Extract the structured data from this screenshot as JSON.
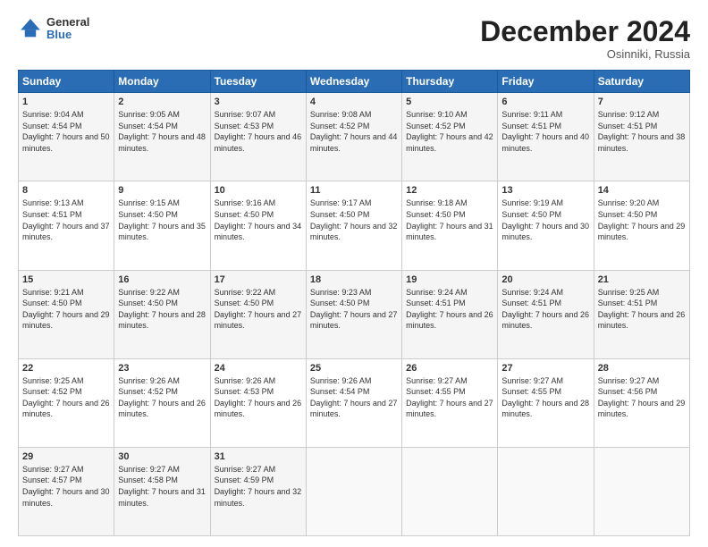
{
  "logo": {
    "general": "General",
    "blue": "Blue"
  },
  "header": {
    "month": "December 2024",
    "location": "Osinniki, Russia"
  },
  "weekdays": [
    "Sunday",
    "Monday",
    "Tuesday",
    "Wednesday",
    "Thursday",
    "Friday",
    "Saturday"
  ],
  "weeks": [
    [
      {
        "day": "1",
        "sunrise": "9:04 AM",
        "sunset": "4:54 PM",
        "daylight": "7 hours and 50 minutes."
      },
      {
        "day": "2",
        "sunrise": "9:05 AM",
        "sunset": "4:54 PM",
        "daylight": "7 hours and 48 minutes."
      },
      {
        "day": "3",
        "sunrise": "9:07 AM",
        "sunset": "4:53 PM",
        "daylight": "7 hours and 46 minutes."
      },
      {
        "day": "4",
        "sunrise": "9:08 AM",
        "sunset": "4:52 PM",
        "daylight": "7 hours and 44 minutes."
      },
      {
        "day": "5",
        "sunrise": "9:10 AM",
        "sunset": "4:52 PM",
        "daylight": "7 hours and 42 minutes."
      },
      {
        "day": "6",
        "sunrise": "9:11 AM",
        "sunset": "4:51 PM",
        "daylight": "7 hours and 40 minutes."
      },
      {
        "day": "7",
        "sunrise": "9:12 AM",
        "sunset": "4:51 PM",
        "daylight": "7 hours and 38 minutes."
      }
    ],
    [
      {
        "day": "8",
        "sunrise": "9:13 AM",
        "sunset": "4:51 PM",
        "daylight": "7 hours and 37 minutes."
      },
      {
        "day": "9",
        "sunrise": "9:15 AM",
        "sunset": "4:50 PM",
        "daylight": "7 hours and 35 minutes."
      },
      {
        "day": "10",
        "sunrise": "9:16 AM",
        "sunset": "4:50 PM",
        "daylight": "7 hours and 34 minutes."
      },
      {
        "day": "11",
        "sunrise": "9:17 AM",
        "sunset": "4:50 PM",
        "daylight": "7 hours and 32 minutes."
      },
      {
        "day": "12",
        "sunrise": "9:18 AM",
        "sunset": "4:50 PM",
        "daylight": "7 hours and 31 minutes."
      },
      {
        "day": "13",
        "sunrise": "9:19 AM",
        "sunset": "4:50 PM",
        "daylight": "7 hours and 30 minutes."
      },
      {
        "day": "14",
        "sunrise": "9:20 AM",
        "sunset": "4:50 PM",
        "daylight": "7 hours and 29 minutes."
      }
    ],
    [
      {
        "day": "15",
        "sunrise": "9:21 AM",
        "sunset": "4:50 PM",
        "daylight": "7 hours and 29 minutes."
      },
      {
        "day": "16",
        "sunrise": "9:22 AM",
        "sunset": "4:50 PM",
        "daylight": "7 hours and 28 minutes."
      },
      {
        "day": "17",
        "sunrise": "9:22 AM",
        "sunset": "4:50 PM",
        "daylight": "7 hours and 27 minutes."
      },
      {
        "day": "18",
        "sunrise": "9:23 AM",
        "sunset": "4:50 PM",
        "daylight": "7 hours and 27 minutes."
      },
      {
        "day": "19",
        "sunrise": "9:24 AM",
        "sunset": "4:51 PM",
        "daylight": "7 hours and 26 minutes."
      },
      {
        "day": "20",
        "sunrise": "9:24 AM",
        "sunset": "4:51 PM",
        "daylight": "7 hours and 26 minutes."
      },
      {
        "day": "21",
        "sunrise": "9:25 AM",
        "sunset": "4:51 PM",
        "daylight": "7 hours and 26 minutes."
      }
    ],
    [
      {
        "day": "22",
        "sunrise": "9:25 AM",
        "sunset": "4:52 PM",
        "daylight": "7 hours and 26 minutes."
      },
      {
        "day": "23",
        "sunrise": "9:26 AM",
        "sunset": "4:52 PM",
        "daylight": "7 hours and 26 minutes."
      },
      {
        "day": "24",
        "sunrise": "9:26 AM",
        "sunset": "4:53 PM",
        "daylight": "7 hours and 26 minutes."
      },
      {
        "day": "25",
        "sunrise": "9:26 AM",
        "sunset": "4:54 PM",
        "daylight": "7 hours and 27 minutes."
      },
      {
        "day": "26",
        "sunrise": "9:27 AM",
        "sunset": "4:55 PM",
        "daylight": "7 hours and 27 minutes."
      },
      {
        "day": "27",
        "sunrise": "9:27 AM",
        "sunset": "4:55 PM",
        "daylight": "7 hours and 28 minutes."
      },
      {
        "day": "28",
        "sunrise": "9:27 AM",
        "sunset": "4:56 PM",
        "daylight": "7 hours and 29 minutes."
      }
    ],
    [
      {
        "day": "29",
        "sunrise": "9:27 AM",
        "sunset": "4:57 PM",
        "daylight": "7 hours and 30 minutes."
      },
      {
        "day": "30",
        "sunrise": "9:27 AM",
        "sunset": "4:58 PM",
        "daylight": "7 hours and 31 minutes."
      },
      {
        "day": "31",
        "sunrise": "9:27 AM",
        "sunset": "4:59 PM",
        "daylight": "7 hours and 32 minutes."
      },
      null,
      null,
      null,
      null
    ]
  ]
}
